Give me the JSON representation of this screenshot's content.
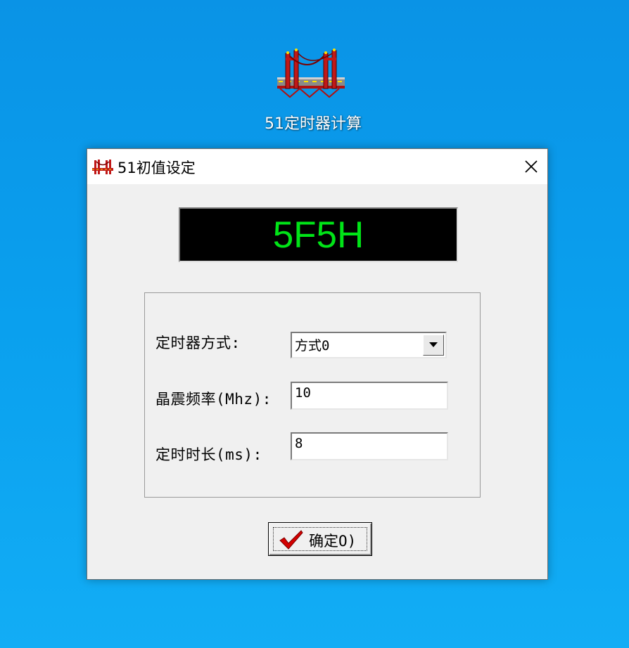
{
  "desktop": {
    "icon_label": "51定时器计算",
    "icon_name": "bridge-icon"
  },
  "window": {
    "title": "51初值设定",
    "close_icon": "close-icon",
    "display_value": "5F5H",
    "display_color": "#00e417",
    "form": {
      "mode_label": "定时器方式:",
      "mode_value": "方式0",
      "freq_label": "晶震频率(Mhz):",
      "freq_value": "10",
      "duration_label": "定时时长(ms):",
      "duration_value": "8"
    },
    "ok_label": "确定O)"
  }
}
